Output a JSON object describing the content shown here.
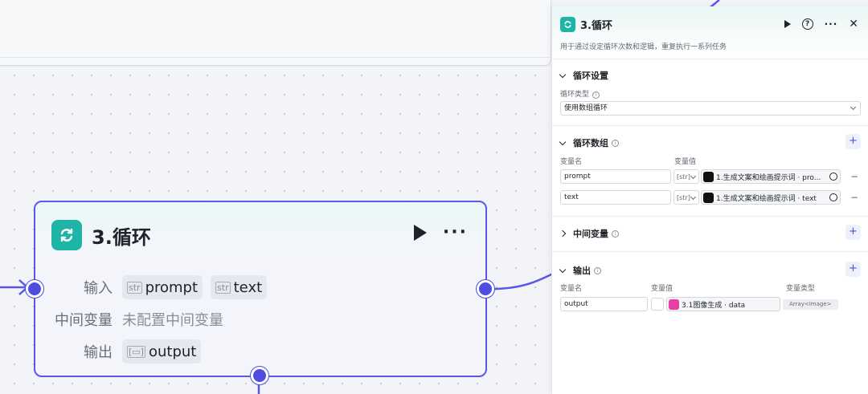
{
  "node": {
    "title": "3.循环",
    "input_label": "输入",
    "inputs": [
      {
        "type_tag": "str",
        "name": "prompt"
      },
      {
        "type_tag": "str",
        "name": "text"
      }
    ],
    "intermediate_label": "中间变量",
    "intermediate_value": "未配置中间变量",
    "output_label": "输出",
    "outputs": [
      {
        "name": "output"
      }
    ]
  },
  "panel": {
    "title": "3.循环",
    "description": "用于通过设定循环次数和逻辑，重复执行一系列任务",
    "loop_settings": {
      "section_title": "循环设置",
      "type_label": "循环类型",
      "type_value": "使用数组循环"
    },
    "loop_array": {
      "section_title": "循环数组",
      "col_name": "变量名",
      "col_value": "变量值",
      "rows": [
        {
          "name": "prompt",
          "type_tag": "[str]",
          "ref": "1.生成文案和绘画提示词 · pro..."
        },
        {
          "name": "text",
          "type_tag": "[str]",
          "ref": "1.生成文案和绘画提示词 · text"
        }
      ]
    },
    "intermediate": {
      "section_title": "中间变量"
    },
    "output": {
      "section_title": "输出",
      "col_name": "变量名",
      "col_value": "变量值",
      "col_type": "变量类型",
      "rows": [
        {
          "name": "output",
          "ref": "3.1图像生成 · data",
          "var_type": "Array<Image>"
        }
      ]
    }
  },
  "colors": {
    "accent": "#4f4ce0",
    "node_icon": "#1fb5a6",
    "image_ref": "#e63fa6"
  },
  "icons": {
    "node": "loop-icon",
    "play": "play-icon",
    "more": "more-icon",
    "help": "help-icon",
    "close": "close-icon"
  }
}
